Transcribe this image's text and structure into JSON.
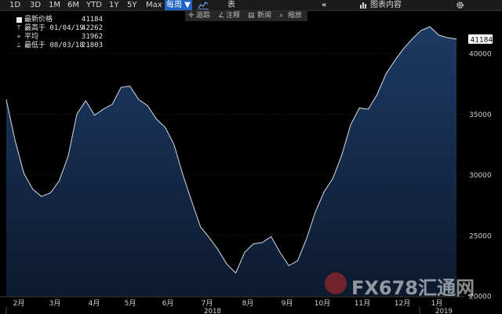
{
  "toolbar": {
    "periods": [
      "1D",
      "3D",
      "1M",
      "6M",
      "YTD",
      "1Y",
      "5Y",
      "Max"
    ],
    "frequency": "每周 ▼",
    "table_label": "表",
    "collapse_icon": "«",
    "chart_content_label": "图表内容",
    "settings_icon": "gear-icon"
  },
  "subtoolbar": {
    "track": "追踪",
    "annotate": "注释",
    "news": "新闻",
    "zoom": "缩放"
  },
  "legend": {
    "latest": {
      "label": "最新价格",
      "value": "41184"
    },
    "high": {
      "label": "最高于 01/04/19",
      "value": "42262"
    },
    "avg": {
      "label": "平均",
      "value": "31962"
    },
    "low": {
      "label": "最低于 08/03/18",
      "value": "21803"
    }
  },
  "watermark": "FX678汇通网",
  "colors": {
    "line": "#d6dde8",
    "area_top": "#1d3a63",
    "area_bottom": "#0c1a2e",
    "grid": "#3a3a3a",
    "last_tag_bg": "#ffffff"
  },
  "chart_data": {
    "type": "area",
    "ylim": [
      20000,
      43500
    ],
    "yticks": [
      20000,
      25000,
      30000,
      35000,
      40000
    ],
    "ytick_labels": [
      "20000",
      "25000",
      "30000",
      "35000",
      "40000"
    ],
    "last_value_label": "41184",
    "months": [
      "2月",
      "3月",
      "4月",
      "5月",
      "6月",
      "7月",
      "8月",
      "9月",
      "10月",
      "11月",
      "12月",
      "1月"
    ],
    "years": [
      "2018",
      "2019"
    ],
    "grid": true,
    "values": [
      36200,
      32800,
      30100,
      28800,
      28200,
      28500,
      29500,
      31500,
      35000,
      36100,
      34900,
      35400,
      35800,
      37200,
      37300,
      36200,
      35700,
      34600,
      33900,
      32500,
      30000,
      27800,
      25700,
      24800,
      23800,
      22600,
      21900,
      23600,
      24300,
      24400,
      24900,
      23600,
      22500,
      22900,
      24700,
      26900,
      28600,
      29700,
      31600,
      34100,
      35500,
      35400,
      36600,
      38300,
      39400,
      40400,
      41200,
      41900,
      42200,
      41500,
      41300,
      41184
    ]
  }
}
